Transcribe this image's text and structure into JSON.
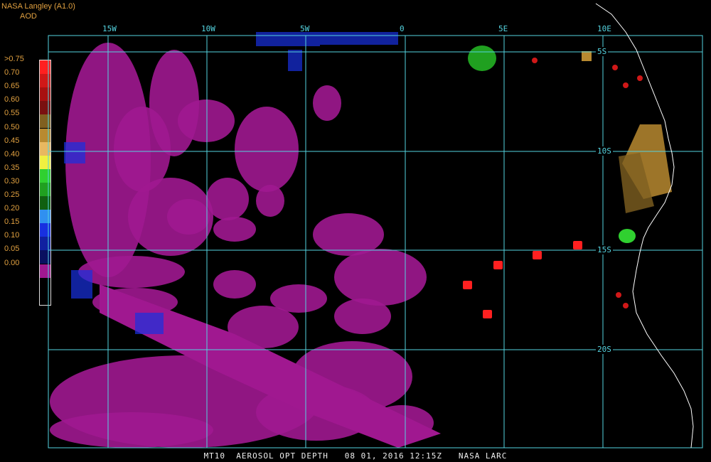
{
  "header": {
    "line1": "NASA Langley (A1.0)",
    "line2": "AOD"
  },
  "colorbar": [
    {
      "label": ">0.75",
      "color": "#ff2020"
    },
    {
      "label": "0.70",
      "color": "#d01818"
    },
    {
      "label": "0.65",
      "color": "#a81010"
    },
    {
      "label": "0.60",
      "color": "#7a1010"
    },
    {
      "label": "0.55",
      "color": "#806020"
    },
    {
      "label": "0.50",
      "color": "#b88a30"
    },
    {
      "label": "0.45",
      "color": "#e8b860"
    },
    {
      "label": "0.40",
      "color": "#f0f040"
    },
    {
      "label": "0.35",
      "color": "#30d030"
    },
    {
      "label": "0.30",
      "color": "#20a020"
    },
    {
      "label": "0.25",
      "color": "#106010"
    },
    {
      "label": "0.20",
      "color": "#3090f0"
    },
    {
      "label": "0.15",
      "color": "#1830e0"
    },
    {
      "label": "0.10",
      "color": "#1020a0"
    },
    {
      "label": "0.05",
      "color": "#0a1060"
    },
    {
      "label": "0.00",
      "color": "#a01890"
    }
  ],
  "longitude_labels": [
    "15W",
    "10W",
    "5W",
    "0",
    "5E",
    "10E"
  ],
  "latitude_labels": [
    "5S",
    "10S",
    "15S",
    "20S"
  ],
  "footer": "MT10  AEROSOL OPT DEPTH   08 01, 2016 12:15Z   NASA LARC",
  "colors": {
    "grid": "#55d4e0",
    "coast": "#ffffff",
    "aod_low": "#a01890",
    "aod_high": "#ff2020"
  }
}
